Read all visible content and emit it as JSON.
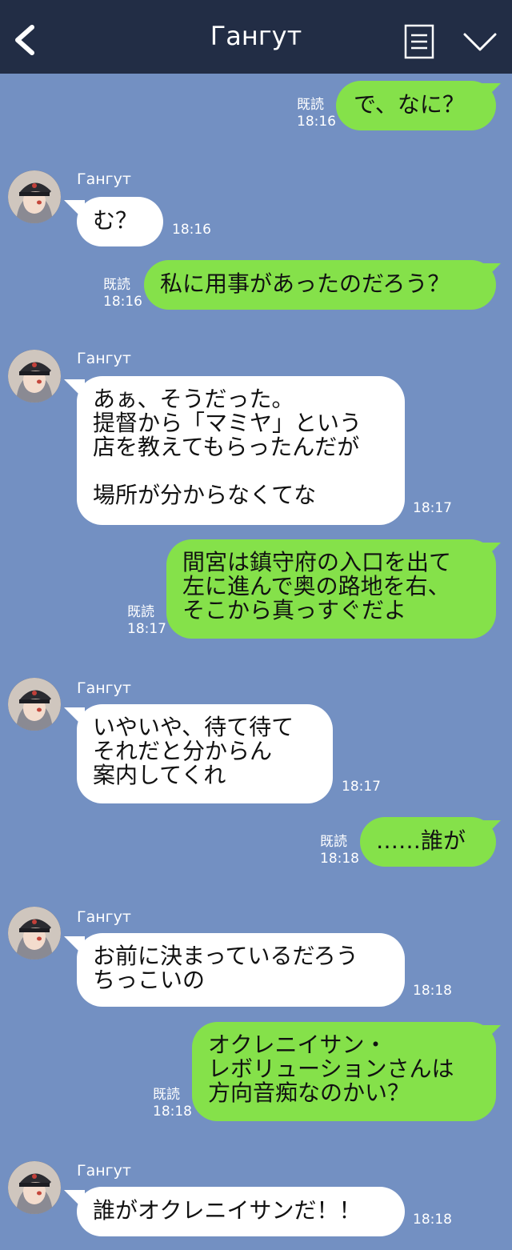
{
  "header": {
    "title": "Гангут"
  },
  "messages": [
    {
      "side": "sent",
      "text": "で、なに？",
      "read": "既読",
      "time": "18:16"
    },
    {
      "side": "recv",
      "sender": "Гангут",
      "text": "む？",
      "time": "18:16"
    },
    {
      "side": "sent",
      "text": "私に用事があったのだろう？",
      "read": "既読",
      "time": "18:16"
    },
    {
      "side": "recv",
      "sender": "Гангут",
      "text": "あぁ、そうだった。\n提督から「マミヤ」という\n店を教えてもらったんだが\n\n場所が分からなくてな",
      "time": "18:17"
    },
    {
      "side": "sent",
      "text": "間宮は鎮守府の入口を出て\n左に進んで奥の路地を右、\nそこから真っすぐだよ",
      "read": "既読",
      "time": "18:17"
    },
    {
      "side": "recv",
      "sender": "Гангут",
      "text": "いやいや、待て待て\nそれだと分からん\n案内してくれ",
      "time": "18:17"
    },
    {
      "side": "sent",
      "text": "……誰が",
      "read": "既読",
      "time": "18:18"
    },
    {
      "side": "recv",
      "sender": "Гангут",
      "text": "お前に決まっているだろう\nちっこいの",
      "time": "18:18"
    },
    {
      "side": "sent",
      "text": "オクレニイサン・\nレボリューションさんは\n方向音痴なのかい？",
      "read": "既読",
      "time": "18:18"
    },
    {
      "side": "recv",
      "sender": "Гангут",
      "text": "誰がオクレニイサンだ！！",
      "time": "18:18"
    }
  ]
}
